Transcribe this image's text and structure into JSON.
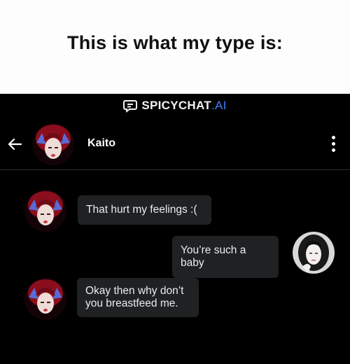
{
  "caption": "This is what my type is:",
  "brand": {
    "name": "SPICYCHAT",
    "suffix": ".AI",
    "accent": "#3b82f6"
  },
  "header": {
    "character_name": "Kaito"
  },
  "messages": [
    {
      "from": "character",
      "text": "That hurt my feelings :("
    },
    {
      "from": "user",
      "text": "You’re such a baby"
    },
    {
      "from": "character",
      "text": "Okay then why don’t you breastfeed me."
    }
  ],
  "icons": {
    "back": "arrow-left-icon",
    "menu": "more-vertical-icon",
    "logo": "chat-bubble-icon"
  },
  "colors": {
    "background": "#000000",
    "bubble": "#1f2123",
    "caption_bg": "#fdfdfd"
  }
}
